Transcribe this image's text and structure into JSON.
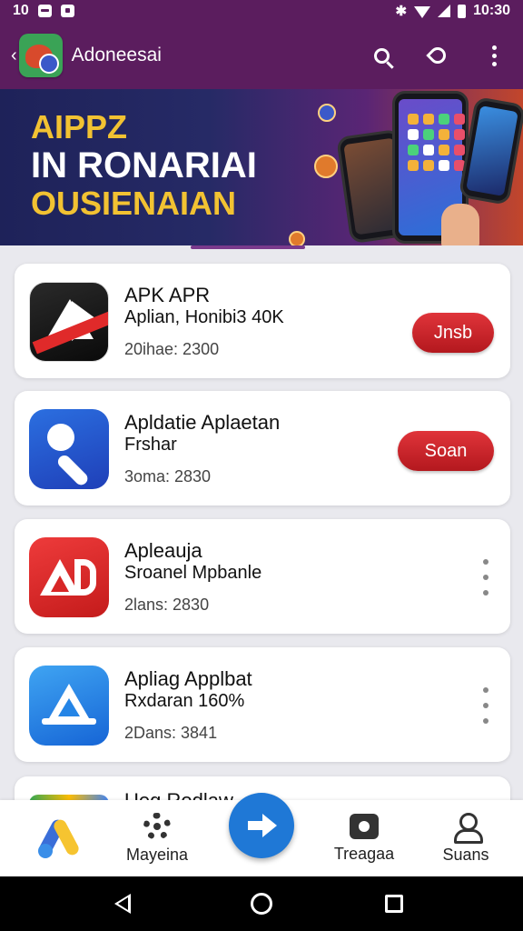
{
  "status_bar": {
    "time_left": "10",
    "time_right": "10:30"
  },
  "app_bar": {
    "title": "Adoneesai"
  },
  "banner": {
    "line1": "AIPPZ",
    "line2": "IN RONARIAI",
    "line3": "OUSIENAIAN"
  },
  "apps": [
    {
      "title": "APK APR",
      "subtitle": "Aplian, Honibi3 40K",
      "meta": "20ihae: 2300",
      "action": "Jnsb",
      "action_type": "button",
      "icon": "apk-logo-icon"
    },
    {
      "title": "Apldatie Aplaetan",
      "subtitle": "Frshar",
      "meta": "3oma: 2830",
      "action": "Soan",
      "action_type": "button",
      "icon": "key-icon"
    },
    {
      "title": "Apleauja",
      "subtitle": "Sroanel Mpbanle",
      "meta": "2lans: 2830",
      "action_type": "more",
      "icon": "ap-logo-icon"
    },
    {
      "title": "Apliag Applbat",
      "subtitle": "Rxdaran 160%",
      "meta": "2Dans: 3841",
      "action_type": "more",
      "icon": "app-store-icon"
    },
    {
      "title": "Ueg Rodlaw",
      "icon": "partial-app-icon"
    }
  ],
  "bottom_nav": {
    "items": [
      {
        "label": "",
        "icon": "home-logo-icon"
      },
      {
        "label": "Mayeina",
        "icon": "gear-icon"
      },
      {
        "label": "",
        "icon": "arrow-icon"
      },
      {
        "label": "Treagaa",
        "icon": "bag-icon"
      },
      {
        "label": "Suans",
        "icon": "user-icon"
      }
    ]
  },
  "colors": {
    "primary": "#5b1d5e",
    "accent": "#c41b1b",
    "fab": "#1f78d6"
  }
}
